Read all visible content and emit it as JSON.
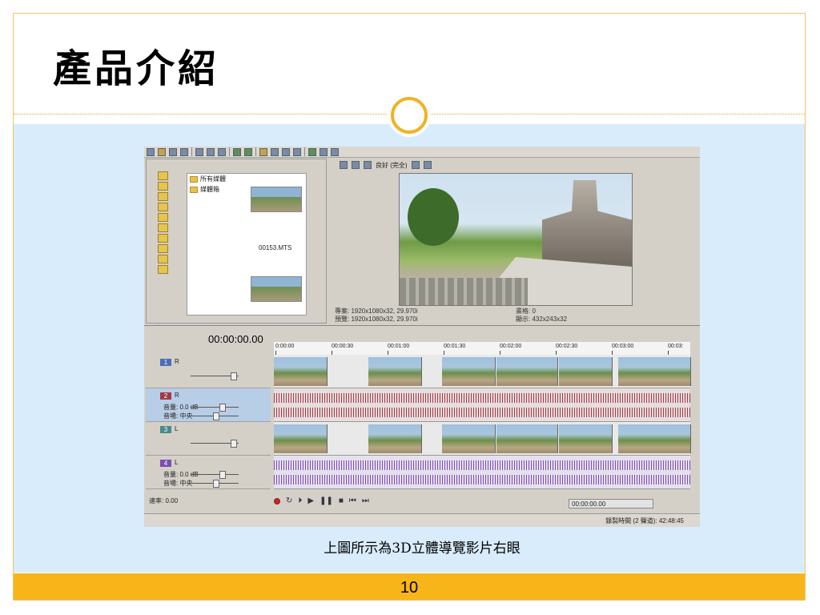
{
  "slide": {
    "title": "產品介紹",
    "caption": "上圖所示為3D立體導覽影片右眼",
    "page_number": "10"
  },
  "colors": {
    "accent": "#f8b519",
    "content_bg": "#d8ecfb",
    "frame": "#f2c26a"
  },
  "app": {
    "explorer": {
      "tree": [
        "所有媒體",
        "媒體箱"
      ],
      "clip_name": "00153.MTS",
      "nav": "< >"
    },
    "preview": {
      "quality": "良好 (完全)",
      "project_label": "專案: 1920x1080x32, 29.970i",
      "preview_label": "預覽: 1920x1080x32, 29.970i",
      "frame_label": "畫格: 0",
      "display_label": "顯示: 432x243x32"
    },
    "timeline": {
      "timecode": "00:00:00.00",
      "ruler": [
        "0:00:00",
        "00:00:30",
        "00:01:00",
        "00:01:30",
        "00:02:00",
        "00:02:30",
        "00:03:00",
        "00:03:"
      ],
      "tracks": [
        {
          "num": "1",
          "ch": "R",
          "type": "video",
          "color": "#4a6fb4"
        },
        {
          "num": "2",
          "ch": "R",
          "type": "audio",
          "color": "#a23a46",
          "volume_label": "音量:",
          "volume": "0.0 dB",
          "pan_label": "音場:",
          "pan": "中央"
        },
        {
          "num": "3",
          "ch": "L",
          "type": "video",
          "color": "#4a8a8a"
        },
        {
          "num": "4",
          "ch": "L",
          "type": "audio",
          "color": "#7d4db3",
          "volume_label": "音量:",
          "volume": "0.0 dB",
          "pan_label": "音場:",
          "pan": "中央"
        }
      ],
      "rate": "速率: 0.00",
      "transport_time": "00:00:00.00",
      "status": "錄製時間 (2 聲道): 42:48:45"
    }
  }
}
